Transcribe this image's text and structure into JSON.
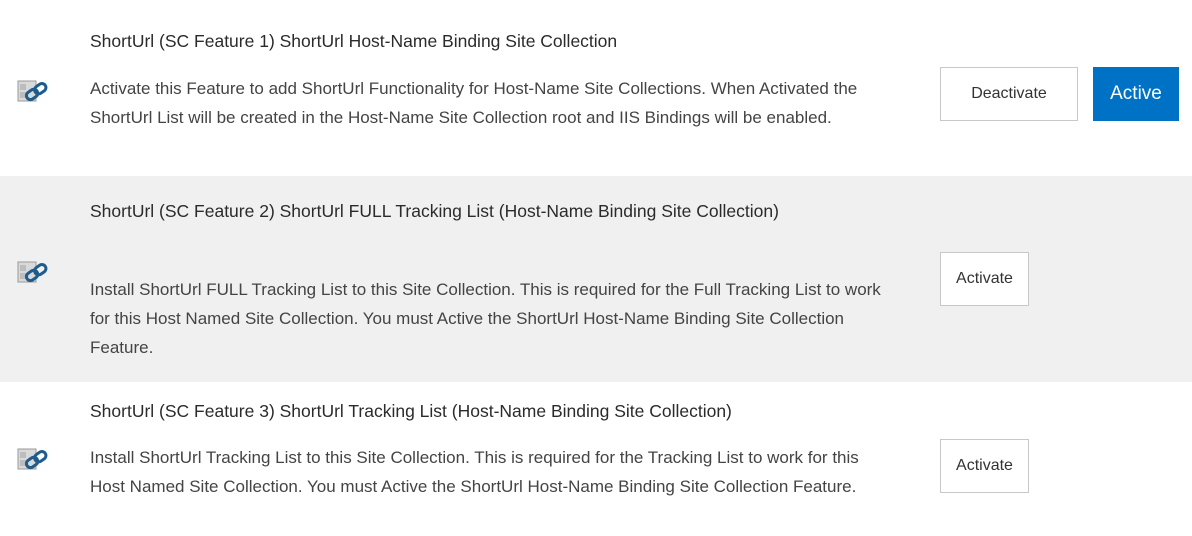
{
  "features": [
    {
      "icon": "feature-link-icon",
      "title": "ShortUrl (SC Feature 1) ShortUrl Host-Name Binding Site Collection",
      "description": "Activate this Feature to add ShortUrl Functionality for Host-Name Site Collections. When Activated the ShortUrl List will be created in the Host-Name Site Collection root and IIS Bindings will be enabled.",
      "deactivate_label": "Deactivate",
      "status_label": "Active"
    },
    {
      "icon": "feature-link-icon",
      "title": "ShortUrl (SC Feature 2) ShortUrl FULL Tracking List (Host-Name Binding Site Collection)",
      "description": "Install ShortUrl FULL Tracking List to this Site Collection. This is required for the Full Tracking List to work for this Host Named Site Collection. You must Active the ShortUrl Host-Name Binding Site Collection Feature.",
      "activate_label": "Activate"
    },
    {
      "icon": "feature-link-icon",
      "title": "ShortUrl (SC Feature 3) ShortUrl Tracking List (Host-Name Binding Site Collection)",
      "description": "Install ShortUrl Tracking List to this Site Collection. This is required for the Tracking List to work for this Host Named Site Collection. You must Active the ShortUrl Host-Name Binding Site Collection Feature.",
      "activate_label": "Activate"
    }
  ],
  "colors": {
    "active_button": "#0072c6",
    "alt_row_background": "#f0f0f0",
    "button_border": "#c8c8c8"
  }
}
